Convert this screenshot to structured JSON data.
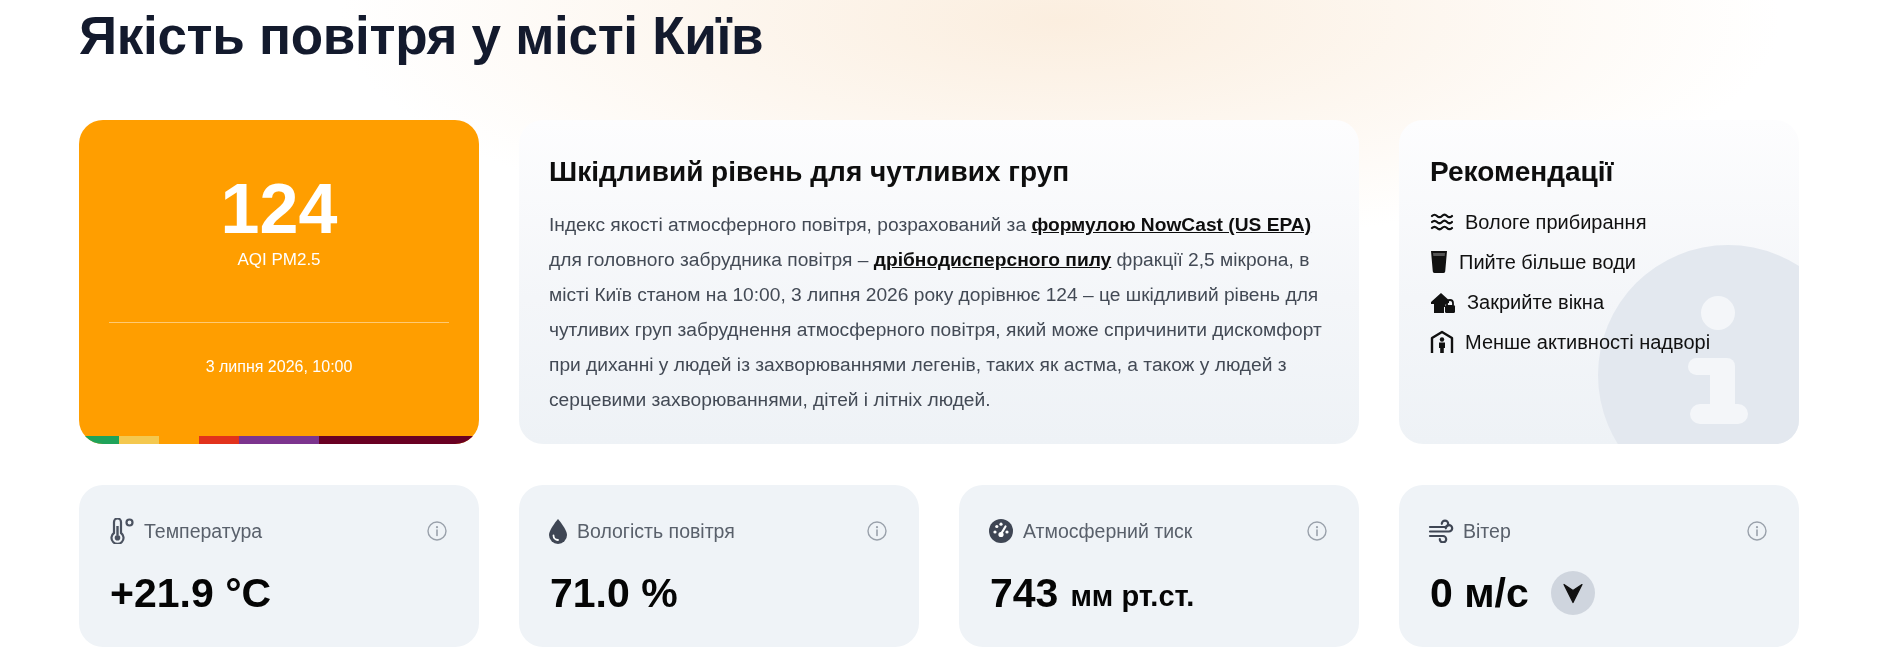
{
  "title": "Якість повітря у місті Київ",
  "aqi": {
    "value": "124",
    "label": "AQI PM2.5",
    "timestamp": "3 липня 2026, 10:00"
  },
  "summary": {
    "heading": "Шкідливий рівень для чутливих груп",
    "body": [
      {
        "kind": "text",
        "text": "Індекс якості атмосферного повітря, розрахований за "
      },
      {
        "kind": "link",
        "text": "формулою NowCast (US EPA)"
      },
      {
        "kind": "text",
        "text": " для головного забрудника повітря – "
      },
      {
        "kind": "link",
        "text": "дрібнодисперсного пилу"
      },
      {
        "kind": "text",
        "text": " фракції 2,5 мікрона, в місті Київ станом на 10:00, 3 липня 2026 року дорівнює 124 – це шкідливий рівень для чутливих груп забруднення атмосферного повітря, який може спричинити дискомфорт при диханні у людей із захворюваннями легенів, таких як астма, а також у людей з серцевими захворюваннями, дітей і літніх людей."
      }
    ]
  },
  "recommendations": {
    "heading": "Рекомендації",
    "items": [
      {
        "kind": "wet-cleaning",
        "text": "Вологе прибирання"
      },
      {
        "kind": "drink-water",
        "text": "Пийте більше води"
      },
      {
        "kind": "close-windows",
        "text": "Закрийте вікна"
      },
      {
        "kind": "stay-indoors",
        "text": "Менше активності надворі"
      }
    ]
  },
  "metrics": [
    {
      "kind": "temperature",
      "label": "Температура",
      "value": "+21.9 °C"
    },
    {
      "kind": "humidity",
      "label": "Вологість повітря",
      "value": "71.0 %"
    },
    {
      "kind": "pressure",
      "label": "Атмосферний тиск",
      "value": "743",
      "unit": "мм рт.ст."
    },
    {
      "kind": "wind",
      "label": "Вітер",
      "value": "0 м/с"
    }
  ]
}
